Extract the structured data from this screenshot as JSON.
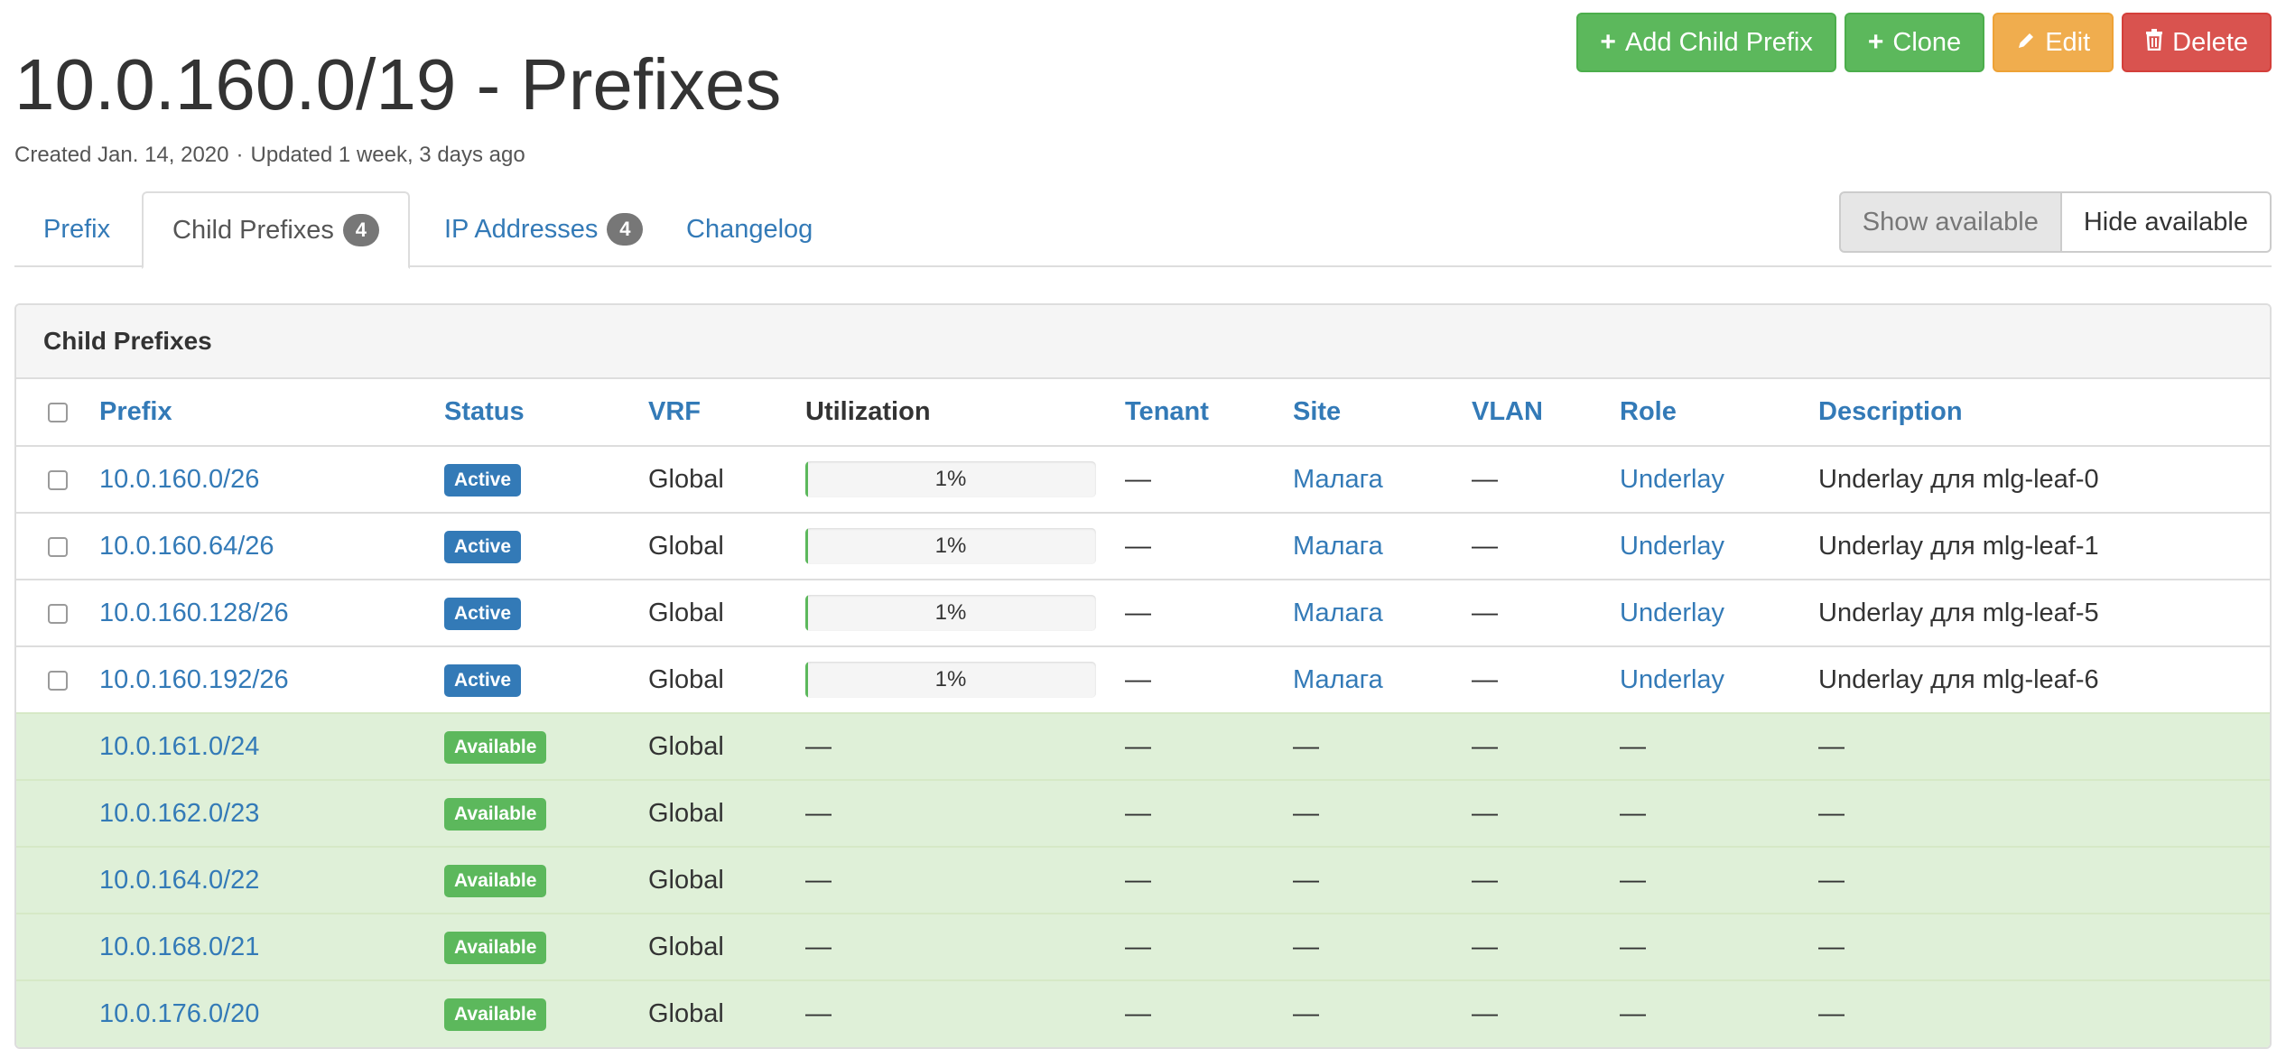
{
  "header": {
    "title": "10.0.160.0/19 - Prefixes",
    "created": "Created Jan. 14, 2020",
    "separator": "·",
    "updated": "Updated 1 week, 3 days ago"
  },
  "actions": {
    "add_child_prefix": "Add Child Prefix",
    "clone": "Clone",
    "edit": "Edit",
    "delete": "Delete"
  },
  "tabs": [
    {
      "label": "Prefix"
    },
    {
      "label": "Child Prefixes",
      "count": "4"
    },
    {
      "label": "IP Addresses",
      "count": "4"
    },
    {
      "label": "Changelog"
    }
  ],
  "toggle": {
    "show": "Show available",
    "hide": "Hide available"
  },
  "panel": {
    "title": "Child Prefixes",
    "columns": [
      "Prefix",
      "Status",
      "VRF",
      "Utilization",
      "Tenant",
      "Site",
      "VLAN",
      "Role",
      "Description"
    ],
    "rows": [
      {
        "prefix": "10.0.160.0/26",
        "status": "Active",
        "vrf": "Global",
        "util_text": "1%",
        "util_value": 1,
        "tenant": "—",
        "site": "Малага",
        "vlan": "—",
        "role": "Underlay",
        "description": "Underlay для mlg-leaf-0"
      },
      {
        "prefix": "10.0.160.64/26",
        "status": "Active",
        "vrf": "Global",
        "util_text": "1%",
        "util_value": 1,
        "tenant": "—",
        "site": "Малага",
        "vlan": "—",
        "role": "Underlay",
        "description": "Underlay для mlg-leaf-1"
      },
      {
        "prefix": "10.0.160.128/26",
        "status": "Active",
        "vrf": "Global",
        "util_text": "1%",
        "util_value": 1,
        "tenant": "—",
        "site": "Малага",
        "vlan": "—",
        "role": "Underlay",
        "description": "Underlay для mlg-leaf-5"
      },
      {
        "prefix": "10.0.160.192/26",
        "status": "Active",
        "vrf": "Global",
        "util_text": "1%",
        "util_value": 1,
        "tenant": "—",
        "site": "Малага",
        "vlan": "—",
        "role": "Underlay",
        "description": "Underlay для mlg-leaf-6"
      },
      {
        "prefix": "10.0.161.0/24",
        "status": "Available",
        "vrf": "Global",
        "util_text": "—",
        "tenant": "—",
        "site": "—",
        "vlan": "—",
        "role": "—",
        "description": "—"
      },
      {
        "prefix": "10.0.162.0/23",
        "status": "Available",
        "vrf": "Global",
        "util_text": "—",
        "tenant": "—",
        "site": "—",
        "vlan": "—",
        "role": "—",
        "description": "—"
      },
      {
        "prefix": "10.0.164.0/22",
        "status": "Available",
        "vrf": "Global",
        "util_text": "—",
        "tenant": "—",
        "site": "—",
        "vlan": "—",
        "role": "—",
        "description": "—"
      },
      {
        "prefix": "10.0.168.0/21",
        "status": "Available",
        "vrf": "Global",
        "util_text": "—",
        "tenant": "—",
        "site": "—",
        "vlan": "—",
        "role": "—",
        "description": "—"
      },
      {
        "prefix": "10.0.176.0/20",
        "status": "Available",
        "vrf": "Global",
        "util_text": "—",
        "tenant": "—",
        "site": "—",
        "vlan": "—",
        "role": "—",
        "description": "—"
      }
    ]
  },
  "colors": {
    "link": "#337ab7",
    "success": "#5cb85c",
    "warning": "#f0ad4e",
    "danger": "#d9534f",
    "available_row": "#dff0d8"
  },
  "icons": {
    "add": "plus-icon",
    "clone": "plus-icon",
    "edit": "pencil-icon",
    "delete": "trash-icon"
  }
}
